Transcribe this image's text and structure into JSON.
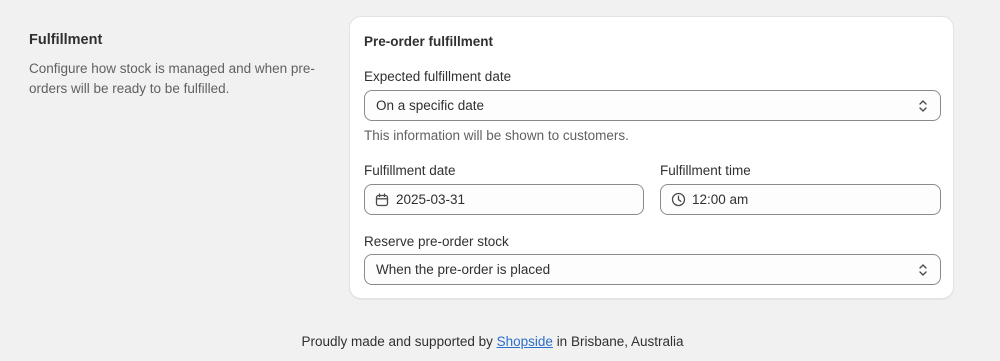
{
  "section": {
    "title": "Fulfillment",
    "description": "Configure how stock is managed and when pre-orders will be ready to be fulfilled."
  },
  "card": {
    "title": "Pre-order fulfillment",
    "expected_date": {
      "label": "Expected fulfillment date",
      "value": "On a specific date",
      "help": "This information will be shown to customers."
    },
    "fulfillment_date": {
      "label": "Fulfillment date",
      "value": "2025-03-31",
      "icon": "calendar-icon"
    },
    "fulfillment_time": {
      "label": "Fulfillment time",
      "value": "12:00 am",
      "icon": "clock-icon"
    },
    "reserve_stock": {
      "label": "Reserve pre-order stock",
      "value": "When the pre-order is placed"
    }
  },
  "footer": {
    "prefix": "Proudly made and supported by",
    "link": "Shopside",
    "suffix": "in Brisbane, Australia"
  },
  "colors": {
    "background": "#f1f1f1",
    "card": "#ffffff",
    "link": "#2c6ecb",
    "muted_text": "#616161"
  }
}
